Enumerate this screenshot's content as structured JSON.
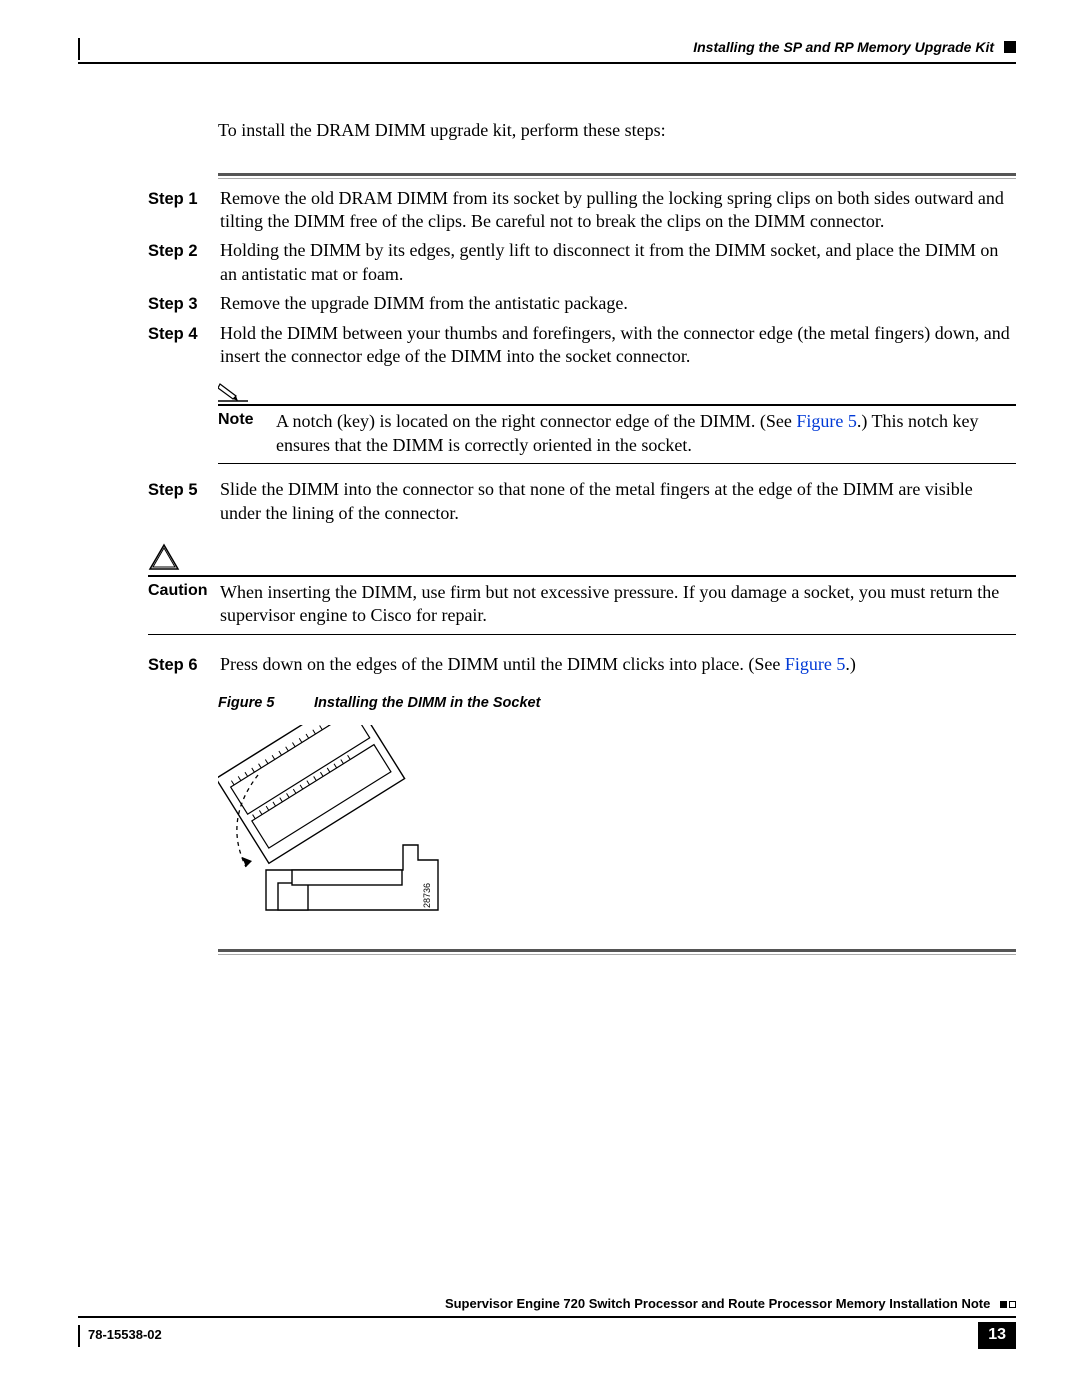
{
  "header": {
    "section_title": "Installing the SP and RP Memory Upgrade Kit"
  },
  "intro": "To install the DRAM DIMM upgrade kit, perform these steps:",
  "steps": {
    "s1": {
      "label": "Step 1",
      "body": "Remove the old DRAM DIMM from its socket by pulling the locking spring clips on both sides outward and tilting the DIMM free of the clips. Be careful not to break the clips on the DIMM connector."
    },
    "s2": {
      "label": "Step 2",
      "body": "Holding the DIMM by its edges, gently lift to disconnect it from the DIMM socket, and place the DIMM on an antistatic mat or foam."
    },
    "s3": {
      "label": "Step 3",
      "body": "Remove the upgrade DIMM from the antistatic package."
    },
    "s4": {
      "label": "Step 4",
      "body": "Hold the DIMM between your thumbs and forefingers, with the connector edge (the metal fingers) down, and insert the connector edge of the DIMM into the socket connector."
    },
    "s5": {
      "label": "Step 5",
      "body": "Slide the DIMM into the connector so that none of the metal fingers at the edge of the DIMM are visible under the lining of the connector."
    },
    "s6": {
      "label": "Step 6",
      "pre": "Press down on the edges of the DIMM until the DIMM clicks into place. (See ",
      "link": "Figure 5",
      "post": ".)"
    }
  },
  "note": {
    "label": "Note",
    "pre": "A notch (key) is located on the right connector edge of the DIMM. (See ",
    "link": "Figure 5",
    "post": ".) This notch key ensures that the DIMM is correctly oriented in the socket."
  },
  "caution": {
    "label": "Caution",
    "body": "When inserting the DIMM, use firm but not excessive pressure. If you damage a socket, you must return the supervisor engine to Cisco for repair."
  },
  "figure": {
    "label": "Figure 5",
    "title": "Installing the DIMM in the Socket",
    "artid": "28736"
  },
  "footer": {
    "doc_title": "Supervisor Engine 720 Switch Processor and Route Processor Memory Installation Note",
    "doc_num": "78-15538-02",
    "page": "13"
  }
}
